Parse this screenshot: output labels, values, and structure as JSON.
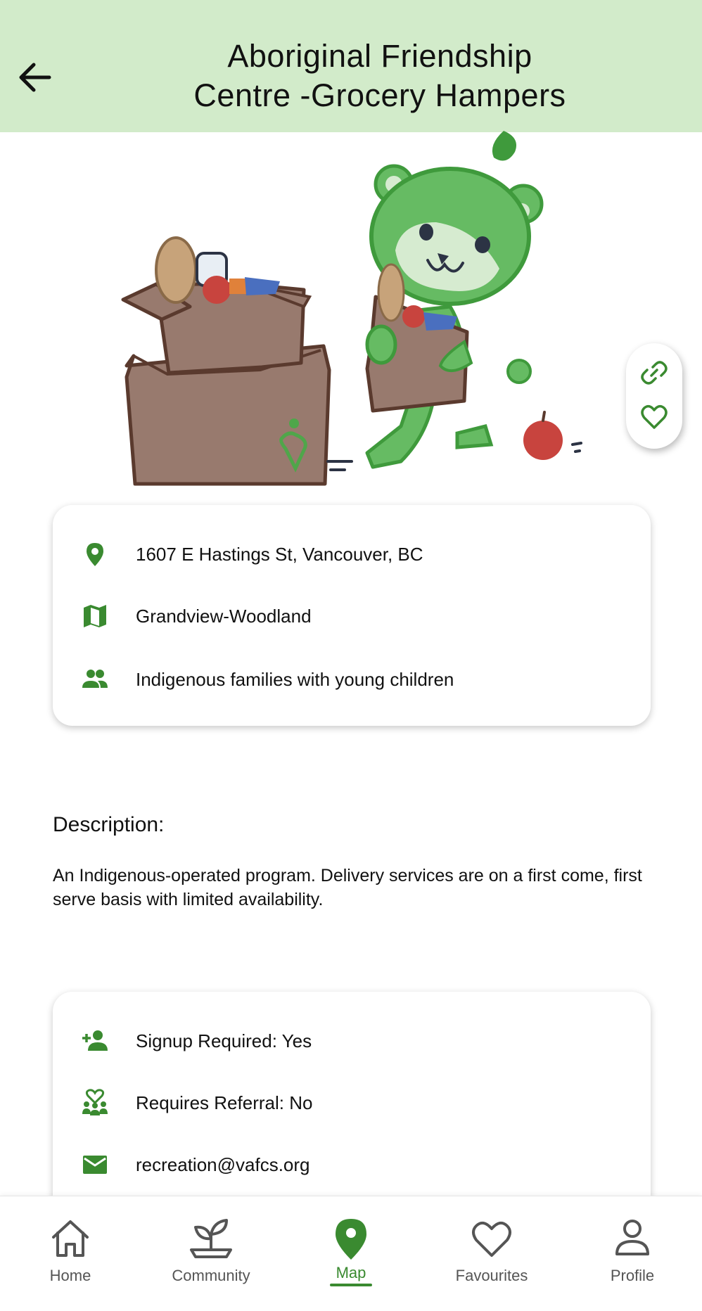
{
  "header": {
    "title_line1": "Aboriginal Friendship",
    "title_line2": "Centre -Grocery Hampers"
  },
  "info": {
    "address": "1607 E Hastings St, Vancouver, BC",
    "neighbourhood": "Grandview-Woodland",
    "audience": "Indigenous families with young children"
  },
  "description": {
    "heading": "Description:",
    "text": "An Indigenous-operated program. Delivery services are on a first come, first serve basis with limited availability."
  },
  "details": {
    "signup": "Signup Required: Yes",
    "referral": "Requires Referral: No",
    "email": "recreation@vafcs.org"
  },
  "nav": {
    "home": "Home",
    "community": "Community",
    "map": "Map",
    "favourites": "Favourites",
    "profile": "Profile",
    "active": "Map"
  },
  "colors": {
    "header_bg": "#d2ebca",
    "accent_green": "#3a8a30",
    "bear_green": "#66bb63",
    "box_brown": "#987a6e"
  }
}
